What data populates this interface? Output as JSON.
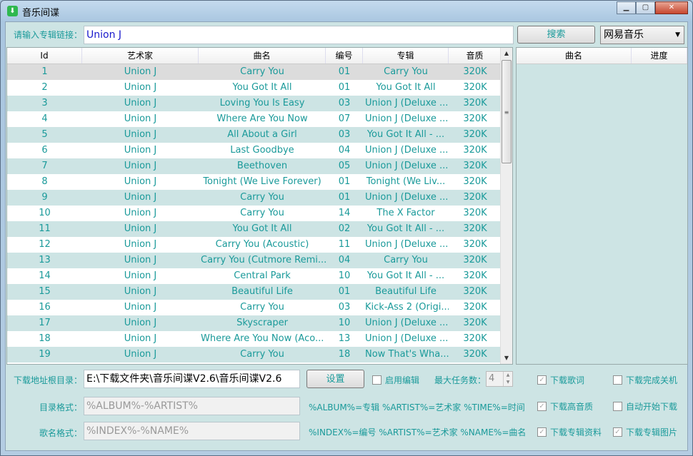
{
  "window": {
    "title": "音乐间谍",
    "controls": [
      "minimize",
      "maximize",
      "close"
    ]
  },
  "search": {
    "label": "请输入专辑链接：",
    "value": "Union J",
    "button": "搜索",
    "source": "网易音乐"
  },
  "table": {
    "headers": [
      "Id",
      "艺术家",
      "曲名",
      "编号",
      "专辑",
      "音质"
    ],
    "rows": [
      [
        "1",
        "Union J",
        "Carry You",
        "01",
        "Carry You",
        "320K"
      ],
      [
        "2",
        "Union J",
        "You Got It All",
        "01",
        "You Got It All",
        "320K"
      ],
      [
        "3",
        "Union J",
        "Loving You Is Easy",
        "03",
        "Union J (Deluxe ...",
        "320K"
      ],
      [
        "4",
        "Union J",
        "Where Are You Now",
        "07",
        "Union J (Deluxe ...",
        "320K"
      ],
      [
        "5",
        "Union J",
        "All About a Girl",
        "03",
        "You Got It All - ...",
        "320K"
      ],
      [
        "6",
        "Union J",
        "Last Goodbye",
        "04",
        "Union J (Deluxe ...",
        "320K"
      ],
      [
        "7",
        "Union J",
        "Beethoven",
        "05",
        "Union J (Deluxe ...",
        "320K"
      ],
      [
        "8",
        "Union J",
        "Tonight (We Live Forever)",
        "01",
        "Tonight (We Liv...",
        "320K"
      ],
      [
        "9",
        "Union J",
        "Carry You",
        "01",
        "Union J (Deluxe ...",
        "320K"
      ],
      [
        "10",
        "Union J",
        "Carry You",
        "14",
        "The X Factor",
        "320K"
      ],
      [
        "11",
        "Union J",
        "You Got It All",
        "02",
        "You Got It All - ...",
        "320K"
      ],
      [
        "12",
        "Union J",
        "Carry You (Acoustic)",
        "11",
        "Union J (Deluxe ...",
        "320K"
      ],
      [
        "13",
        "Union J",
        "Carry You (Cutmore Remi...",
        "04",
        "Carry You",
        "320K"
      ],
      [
        "14",
        "Union J",
        "Central Park",
        "10",
        "You Got It All - ...",
        "320K"
      ],
      [
        "15",
        "Union J",
        "Beautiful Life",
        "01",
        "Beautiful Life",
        "320K"
      ],
      [
        "16",
        "Union J",
        "Carry You",
        "03",
        "Kick-Ass 2 (Origi...",
        "320K"
      ],
      [
        "17",
        "Union J",
        "Skyscraper",
        "10",
        "Union J (Deluxe ...",
        "320K"
      ],
      [
        "18",
        "Union J",
        "Where Are You Now (Aco...",
        "13",
        "Union J (Deluxe ...",
        "320K"
      ],
      [
        "19",
        "Union J",
        "Carry You",
        "18",
        "Now That's Wha...",
        "320K"
      ]
    ]
  },
  "queue": {
    "headers": [
      "曲名",
      "进度"
    ]
  },
  "settings": {
    "dir_label": "下载地址根目录：",
    "dir_value": "E:\\下载文件夹\\音乐间谍V2.6\\音乐间谍V2.6",
    "set_button": "设置",
    "enable_edit": "启用编辑",
    "max_tasks_label": "最大任务数：",
    "max_tasks": "4",
    "folder_label": "目录格式：",
    "folder_value": "%ALBUM%-%ARTIST%",
    "folder_hint": "%ALBUM%=专辑 %ARTIST%=艺术家 %TIME%=时间",
    "name_label": "歌名格式：",
    "name_value": "%INDEX%-%NAME%",
    "name_hint": "%INDEX%=编号 %ARTIST%=艺术家 %NAME%=曲名",
    "checks": [
      {
        "label": "下载歌词",
        "checked": true
      },
      {
        "label": "下载完成关机",
        "checked": false
      },
      {
        "label": "下载高音质",
        "checked": true
      },
      {
        "label": "自动开始下载",
        "checked": false
      },
      {
        "label": "下载专辑资料",
        "checked": true
      },
      {
        "label": "下载专辑图片",
        "checked": true
      }
    ]
  }
}
